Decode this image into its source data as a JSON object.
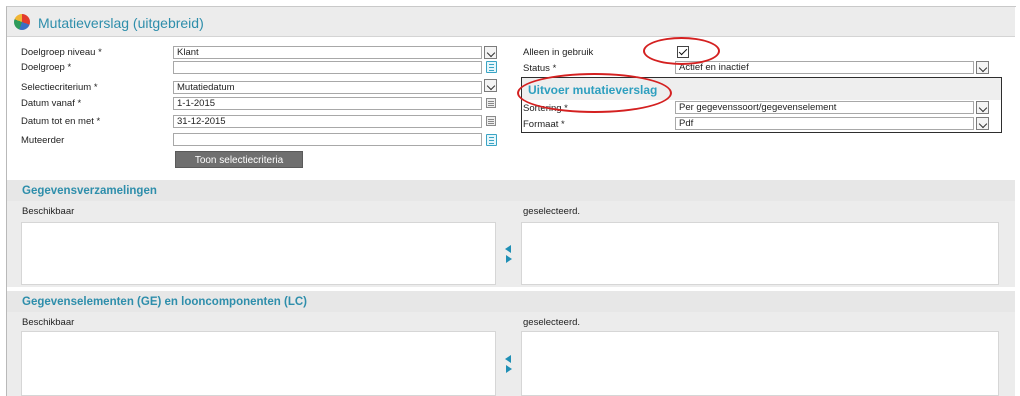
{
  "window": {
    "title": "Mutatieverslag (uitgebreid)",
    "icon": "app-pie-logo-icon"
  },
  "form_left": {
    "doelgroep_niveau": {
      "label": "Doelgroep niveau *",
      "value": "Klant"
    },
    "doelgroep": {
      "label": "Doelgroep *",
      "value": ""
    },
    "selectiecriterium": {
      "label": "Selectiecriterium *",
      "value": "Mutatiedatum"
    },
    "datum_vanaf": {
      "label": "Datum vanaf *",
      "value": "1-1-2015"
    },
    "datum_tot_en_met": {
      "label": "Datum tot en met *",
      "value": "31-12-2015"
    },
    "muteerder": {
      "label": "Muteerder",
      "value": ""
    },
    "toon_button": "Toon selectiecriteria"
  },
  "form_right": {
    "alleen_in_gebruik": {
      "label": "Alleen in gebruik",
      "checked": true
    },
    "status": {
      "label": "Status *",
      "value": "Actief en inactief"
    }
  },
  "uitvoer_panel": {
    "title": "Uitvoer mutatieverslag",
    "sortering": {
      "label": "Sortering *",
      "value": "Per gegevenssoort/gegevenselement"
    },
    "formaat": {
      "label": "Formaat *",
      "value": "Pdf"
    }
  },
  "sections": {
    "gegevensverzamelingen": {
      "title": "Gegevensverzamelingen",
      "available_label": "Beschikbaar",
      "selected_label": "geselecteerd."
    },
    "gegevenselementen": {
      "title": "Gegevenselementen (GE) en looncomponenten (LC)",
      "available_label": "Beschikbaar",
      "selected_label": "geselecteerd."
    }
  },
  "colors": {
    "accent": "#2e8eab",
    "annotation": "#d42020",
    "button": "#6f6f6f"
  }
}
